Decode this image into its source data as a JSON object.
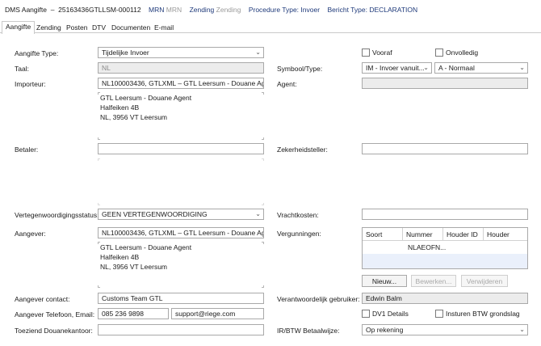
{
  "header": {
    "app": "DMS Aangifte",
    "dossier_number": "25163436GTLLSM-000112",
    "mrn_label": "MRN",
    "mrn_value": "MRN",
    "zending_label": "Zending",
    "zending_value": "Zending",
    "procedure_label": "Procedure Type:",
    "procedure_value": "Invoer",
    "bericht_label": "Bericht Type:",
    "bericht_value": "DECLARATION"
  },
  "tabs": [
    "Aangifte",
    "Zending",
    "Posten",
    "DTV",
    "Documenten",
    "E-mail"
  ],
  "form": {
    "aangifte_type_label": "Aangifte Type:",
    "aangifte_type_value": "Tijdelijke Invoer",
    "vooraf_label": "Vooraf",
    "onvolledig_label": "Onvolledig",
    "taal_label": "Taal:",
    "taal_value": "NL",
    "symbool_label": "Symbool/Type:",
    "symbool_value": "IM - Invoer vanuit...",
    "type_value": "A - Normaal",
    "importeur_label": "Importeur:",
    "importeur_value": "NL100003436, GTLXML – GTL Leersum - Douane Agent",
    "importeur_address": [
      "GTL Leersum - Douane Agent",
      "Halfeiken 4B",
      "NL, 3956 VT Leersum"
    ],
    "agent_label": "Agent:",
    "agent_value": "",
    "betaler_label": "Betaler:",
    "betaler_value": "",
    "zekerheid_label": "Zekerheidsteller:",
    "zekerheid_value": "",
    "vertegenwoordiging_label": "Vertegenwoordigingsstatus:",
    "vertegenwoordiging_value": "GEEN VERTEGENWOORDIGING",
    "vrachtkosten_label": "Vrachtkosten:",
    "vrachtkosten_value": "",
    "aangever_label": "Aangever:",
    "aangever_value": "NL100003436, GTLXML – GTL Leersum - Douane Agent",
    "aangever_address": [
      "GTL Leersum - Douane Agent",
      "Halfeiken 4B",
      "NL, 3956 VT Leersum"
    ],
    "vergunningen_label": "Vergunningen:",
    "vergunningen_columns": [
      "Soort",
      "Nummer",
      "Houder ID",
      "Houder"
    ],
    "vergunningen_rows": [
      [
        "",
        "NLAEOFN...",
        "",
        ""
      ]
    ],
    "nieuw_button": "Nieuw...",
    "bewerken_button": "Bewerken...",
    "verwijderen_button": "Verwijderen",
    "aangever_contact_label": "Aangever contact:",
    "aangever_contact_value": "Customs Team GTL",
    "verantwoordelijk_label": "Verantwoordelijk gebruiker:",
    "verantwoordelijk_value": "Edwin Balm",
    "telefoon_label": "Aangever Telefoon, Email:",
    "telefoon_value": "085 236 9898",
    "email_value": "support@riege.com",
    "dv1_label": "DV1 Details",
    "btw_grondslag_label": "Insturen BTW grondslag",
    "toeziend_label": "Toeziend Douanekantoor:",
    "toeziend_value": "",
    "irbtw_label": "IR/BTW Betaalwijze:",
    "irbtw_value": "Op rekening"
  },
  "colors": {
    "header_label": "#1f3a7a",
    "field_border": "#a9a9a9",
    "readonly_bg": "#ececec"
  }
}
